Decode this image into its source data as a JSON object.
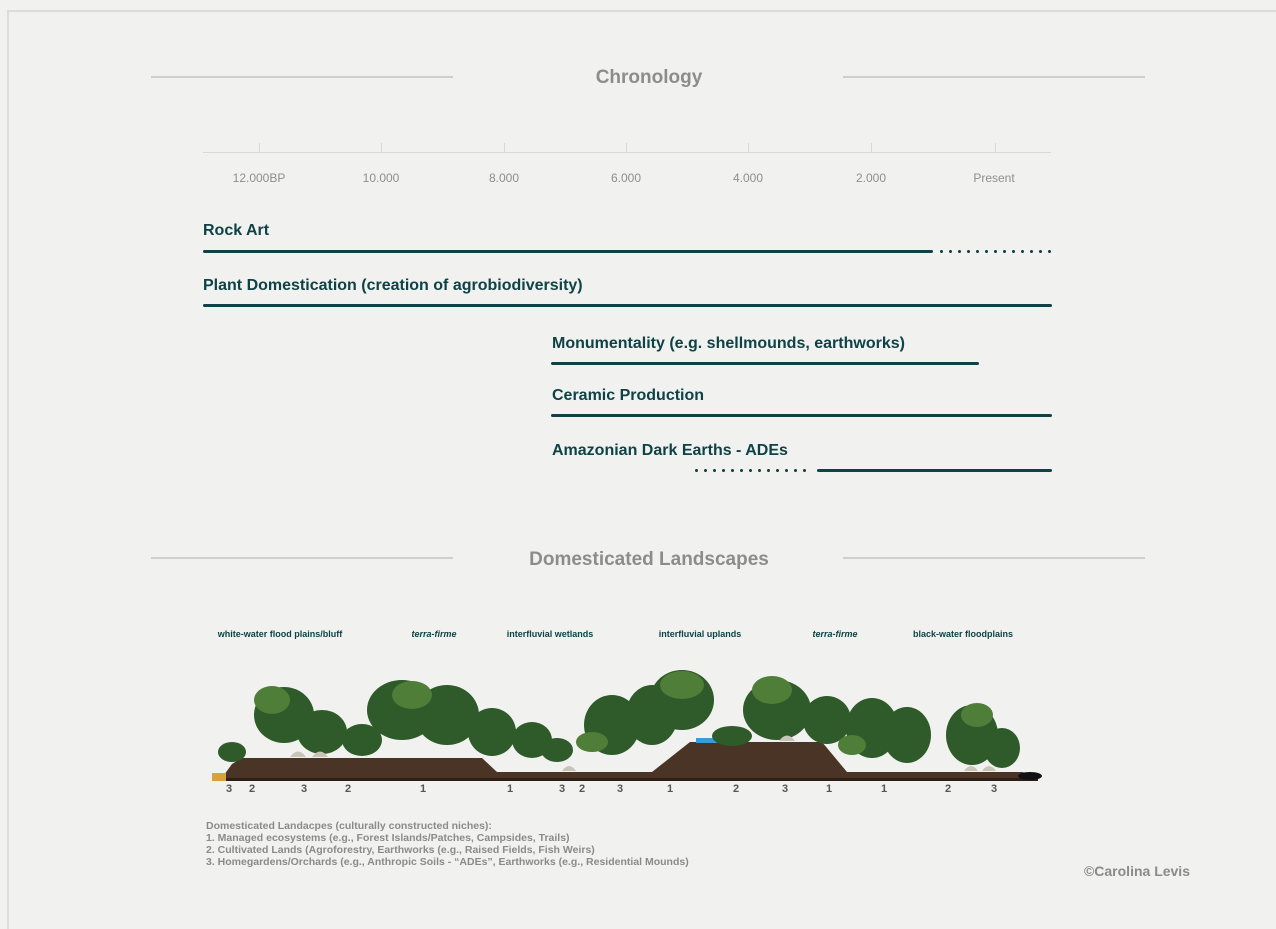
{
  "chronology": {
    "title": "Chronology",
    "ticks": [
      "12.000BP",
      "10.000",
      "8.000",
      "6.000",
      "4.000",
      "2.000",
      "Present"
    ],
    "rows": [
      {
        "label": "Rock Art",
        "solid_from": "12.000BP",
        "solid_to": "~1.000",
        "dotted_to": "Present"
      },
      {
        "label": "Plant Domestication (creation of agrobiodiversity)",
        "solid_from": "12.000BP",
        "solid_to": "Present"
      },
      {
        "label": "Monumentality (e.g. shellmounds, earthworks)",
        "solid_from": "~6.600",
        "solid_to": "~600"
      },
      {
        "label": "Ceramic Production",
        "solid_from": "~6.600",
        "solid_to": "Present"
      },
      {
        "label": "Amazonian Dark Earths - ADEs",
        "dotted_from": "~5.000",
        "solid_from": "~3.000",
        "solid_to": "Present"
      }
    ]
  },
  "landscapes": {
    "title": "Domesticated Landscapes",
    "zones": [
      {
        "label": "white-water flood plains/bluff",
        "italic": false
      },
      {
        "label": "terra-firme",
        "italic": true
      },
      {
        "label": "interfluvial wetlands",
        "italic": false
      },
      {
        "label": "interfluvial uplands",
        "italic": false
      },
      {
        "label": "terra-firme",
        "italic": true
      },
      {
        "label": "black-water floodplains",
        "italic": false
      }
    ],
    "numbers": [
      "3",
      "2",
      "3",
      "2",
      "1",
      "1",
      "3",
      "2",
      "3",
      "1",
      "2",
      "3",
      "1",
      "1",
      "2",
      "3"
    ],
    "legend": [
      "Domesticated Landacpes (culturally constructed niches):",
      "1. Managed ecosystems (e.g., Forest Islands/Patches, Campsides, Trails)",
      "2. Cultivated Lands (Agroforestry, Earthworks (e.g., Raised Fields, Fish Weirs)",
      "3. Homegardens/Orchards (e.g., Anthropic Soils - “ADEs”, Earthworks (e.g., Residential Mounds)"
    ],
    "credit": "©Carolina Levis"
  },
  "colors": {
    "accent": "#0e4246",
    "muted": "#8c8d8a",
    "background": "#f1f2ef"
  }
}
